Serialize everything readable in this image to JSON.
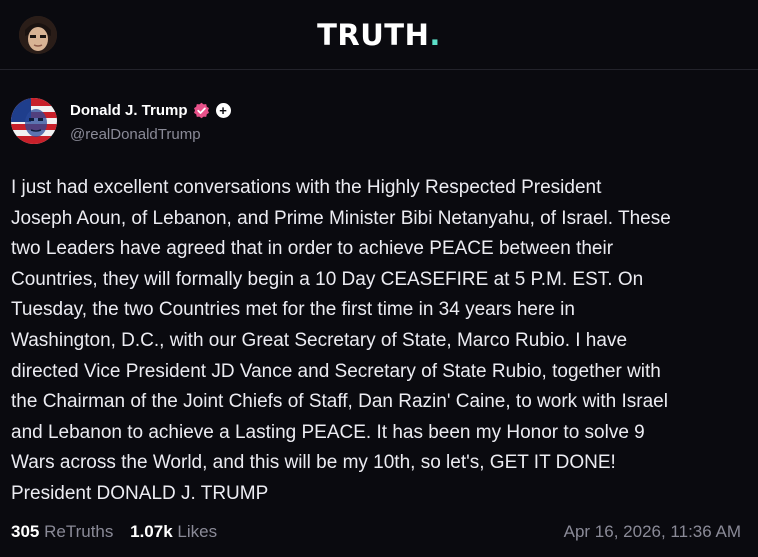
{
  "header": {
    "logo_text": "TRUTH",
    "logo_dot": ".",
    "brand_color": "#5ce0c8"
  },
  "post": {
    "display_name": "Donald J. Trump",
    "handle": "@realDonaldTrump",
    "verified_icon": "verified-badge-icon",
    "verified_color": "#e8518a",
    "plus_icon": "plus-icon",
    "plus_symbol": "+",
    "body": "I just had excellent conversations with the Highly Respected President\nJoseph Aoun, of Lebanon, and Prime Minister Bibi Netanyahu, of Israel. These\ntwo Leaders have agreed that in order to achieve PEACE between their\nCountries, they will formally begin a 10 Day CEASEFIRE at 5 P.M. EST. On\nTuesday, the two Countries met for the first time in 34 years here in\nWashington, D.C., with our Great Secretary of State, Marco Rubio. I have\ndirected Vice President JD Vance and Secretary of State Rubio, together with\nthe Chairman of the Joint Chiefs of Staff, Dan Razin' Caine, to work with Israel\nand Lebanon to achieve a Lasting PEACE. It has been my Honor to solve 9\nWars across the World, and this will be my 10th, so let's, GET IT DONE!\nPresident DONALD J. TRUMP",
    "retruths_count": "305",
    "retruths_label": "ReTruths",
    "likes_count": "1.07k",
    "likes_label": "Likes",
    "timestamp": "Apr 16, 2026, 11:36 AM"
  }
}
